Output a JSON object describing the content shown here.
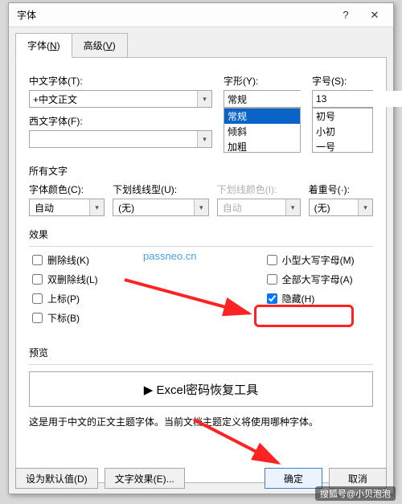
{
  "dialog": {
    "title": "字体",
    "tabs": [
      {
        "label": "字体(N)",
        "hotkey": "N"
      },
      {
        "label": "高级(V)",
        "hotkey": "V"
      }
    ]
  },
  "font_main": {
    "cn_label": "中文字体(T):",
    "cn_value": "+中文正文",
    "west_label": "西文字体(F):",
    "west_value": ""
  },
  "font_style": {
    "label": "字形(Y):",
    "value": "常规",
    "options": [
      "常规",
      "倾斜",
      "加粗"
    ]
  },
  "font_size": {
    "label": "字号(S):",
    "value": "13",
    "options": [
      "初号",
      "小初",
      "一号"
    ]
  },
  "all_text_label": "所有文字",
  "font_color": {
    "label": "字体颜色(C):",
    "value": "自动"
  },
  "underline_style": {
    "label": "下划线线型(U):",
    "value": "(无)"
  },
  "underline_color": {
    "label": "下划线颜色(I):",
    "value": "自动"
  },
  "emphasis": {
    "label": "着重号(·):",
    "value": "(无)"
  },
  "effects_label": "效果",
  "effects": {
    "strike": {
      "label": "删除线(K)",
      "checked": false
    },
    "dblstrike": {
      "label": "双删除线(L)",
      "checked": false
    },
    "superscript": {
      "label": "上标(P)",
      "checked": false
    },
    "subscript": {
      "label": "下标(B)",
      "checked": false
    },
    "smallcaps": {
      "label": "小型大写字母(M)",
      "checked": false
    },
    "allcaps": {
      "label": "全部大写字母(A)",
      "checked": false
    },
    "hidden": {
      "label": "隐藏(H)",
      "checked": true
    }
  },
  "watermark_text": "passneo.cn",
  "preview": {
    "label": "预览",
    "text": "▶ Excel密码恢复工具"
  },
  "footnote": "这是用于中文的正文主题字体。当前文档主题定义将使用哪种字体。",
  "buttons": {
    "default": "设为默认值(D)",
    "texteffects": "文字效果(E)...",
    "ok": "确定",
    "cancel": "取消"
  },
  "page_watermark": "搜狐号@小贝泡泡"
}
